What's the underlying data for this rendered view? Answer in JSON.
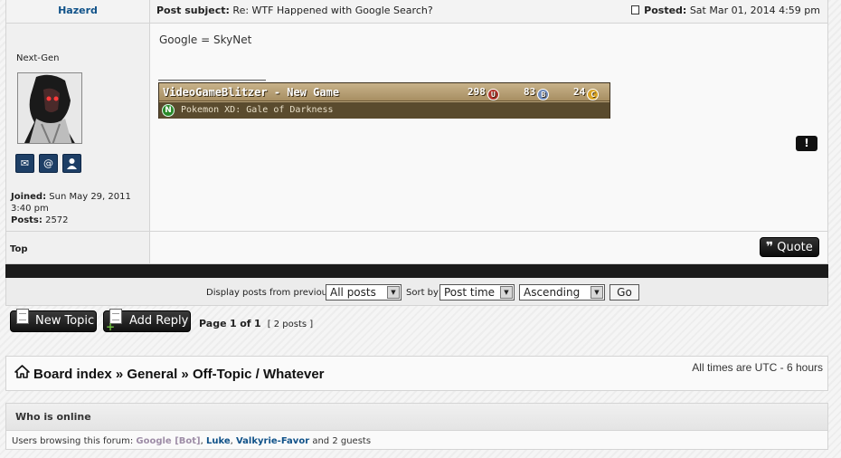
{
  "post": {
    "author": "Hazerd",
    "subject_label": "Post subject:",
    "subject": "Re: WTF Happened with Google Search?",
    "posted_label": "Posted:",
    "posted_date": "Sat Mar 01, 2014 4:59 pm",
    "rank": "Next-Gen",
    "joined_label": "Joined:",
    "joined_value": "Sun May 29, 2011 3:40 pm",
    "posts_label": "Posts:",
    "posts_value": "2572",
    "message": "Google = SkyNet",
    "top_label": "Top",
    "quote_label": "Quote",
    "report_label": "!",
    "contact_icons": [
      "envelope-icon",
      "at-icon",
      "user-icon"
    ]
  },
  "gamecard": {
    "title": "VideoGameBlitzer - New Game",
    "stat1_value": "298",
    "stat1_badge": "U",
    "stat2_value": "83",
    "stat2_badge": "B",
    "stat3_value": "24",
    "stat3_badge": "C",
    "now_playing_badge": "N",
    "now_playing": "Pokemon XD: Gale of Darkness"
  },
  "sort": {
    "display_label": "Display posts from previous:",
    "display_value": "All posts",
    "sort_label": "Sort by",
    "sort_value": "Post time",
    "order_value": "Ascending",
    "go_label": "Go"
  },
  "actions": {
    "new_topic": "New Topic",
    "add_reply": "Add Reply",
    "page_prefix": "Page",
    "page_current": "1",
    "page_of": "of",
    "page_total": "1",
    "post_count": "[ 2 posts ]"
  },
  "breadcrumb": {
    "items": [
      "Board index",
      "General",
      "Off-Topic / Whatever"
    ],
    "separator": "»",
    "timezone": "All times are UTC - 6 hours"
  },
  "online": {
    "title": "Who is online",
    "prefix": "Users browsing this forum:",
    "users": [
      "Google [Bot]",
      "Luke",
      "Valkyrie-Favor"
    ],
    "suffix": "and 2 guests"
  },
  "colors": {
    "accent": "#105289",
    "dark": "#1b1b1b",
    "gamecard": "#b9a37a",
    "bot": "#9e8da7"
  }
}
